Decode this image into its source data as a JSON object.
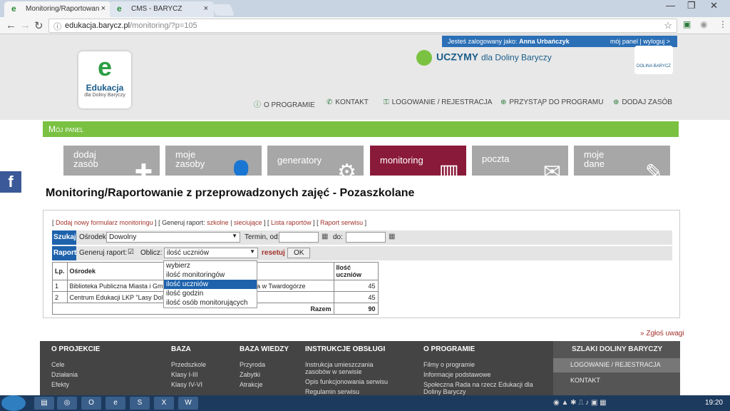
{
  "browser": {
    "tabs": [
      {
        "label": "Monitoring/Raportowan",
        "close": "×",
        "favicon": "e"
      },
      {
        "label": "CMS - BARYCZ",
        "close": "×",
        "favicon": "e"
      }
    ],
    "url_host": "edukacja.barycz.pl",
    "url_path": "/monitoring/?p=105"
  },
  "site": {
    "user_label": "Jesteś zalogowany jako:",
    "user_name": "Anna Urbańczyk",
    "user_links": "mój panel | wyloguj >",
    "logo_mark": "e",
    "logo_title": "Edukacja",
    "logo_sub": "dla Doliny Baryczy",
    "logo2_text": "DOLINA BARYCZ",
    "slogan_bold": "UCZYMY",
    "slogan_rest": "dla Doliny Baryczy",
    "topnav": [
      "O PROGRAMIE",
      "KONTAKT",
      "LOGOWANIE / REJESTRACJA",
      "PRZYSTĄP DO PROGRAMU",
      "DODAJ ZASÓB"
    ],
    "panel_title": "Mój panel",
    "modules": [
      {
        "line1": "dodaj",
        "line2": "zasób"
      },
      {
        "line1": "moje",
        "line2": "zasoby"
      },
      {
        "line1": "generatory",
        "line2": ""
      },
      {
        "line1": "monitoring",
        "line2": ""
      },
      {
        "line1": "poczta",
        "line2": ""
      },
      {
        "line1": "moje",
        "line2": "dane"
      }
    ],
    "facebook": "f",
    "heading": "Monitoring/Raportowanie z przeprowadzonych zajęć - Pozaszkolane"
  },
  "form": {
    "link_add": "Dodaj nowy formularz monitoringu",
    "link_gen_prefix": "Generuj raport:",
    "link_gen_a": "szkolne",
    "link_gen_b": "sieciujące",
    "link_list": "Lista raportów",
    "link_service": "Raport serwisu",
    "search_label": "Szukaj",
    "osrodek_label": "Ośrodek",
    "osrodek_value": "Dowolny",
    "termin_label": "Termin, od:",
    "do_label": "do:",
    "raport_label": "Raport",
    "generuj_label": "Generuj raport:",
    "oblicz_label": "Oblicz:",
    "oblicz_value": "ilość uczniów",
    "reset_label": "resetuj",
    "ok_label": "OK",
    "dropdown_options": [
      "wybierz",
      "ilość monitoringów",
      "ilość uczniów",
      "ilość godzin",
      "ilość osób monitorujących"
    ]
  },
  "table": {
    "headers": [
      "Lp.",
      "Ośrodek",
      "Ilość uczniów"
    ],
    "rows": [
      {
        "lp": "1",
        "name": "Biblioteka Publiczna Miasta i Gm",
        "name_tail": "eymonta w Twardogórze",
        "value": "45"
      },
      {
        "lp": "2",
        "name": "Centrum Edukacji LKP \"Lasy Doli",
        "name_tail": "",
        "value": "45"
      }
    ],
    "total_label": "Razem",
    "total_value": "90"
  },
  "footer": {
    "report": "» Zgłoś uwagi",
    "cols": [
      {
        "title": "O PROJEKCIE",
        "items": [
          "Cele",
          "Działania",
          "Efekty"
        ]
      },
      {
        "title": "BAZA EDUKACYJNA",
        "items": [
          "Przedszkole",
          "Klasy I-III",
          "Klasy IV-VI"
        ]
      },
      {
        "title": "BAZA WIEDZY",
        "items": [
          "Przyroda",
          "Zabytki",
          "Atrakcje"
        ]
      },
      {
        "title": "INSTRUKCJE OBSŁUGI",
        "items": [
          "Instrukcja umieszczania zasobów w serwisie",
          "Opis funkcjonowania serwisu",
          "Regulamin serwisu"
        ]
      },
      {
        "title": "O PROGRAMIE",
        "items": [
          "Filmy o programie",
          "Informacje podstawowe",
          "Społeczna Rada na rzecz Edukacji dla Doliny Baryczy"
        ]
      }
    ],
    "szlaki_title": "SZLAKI DOLINY BARYCZY",
    "szlaki_items": [
      "LOGOWANIE / REJESTRACJA",
      "KONTAKT"
    ]
  },
  "taskbar": {
    "clock": "19:20"
  }
}
